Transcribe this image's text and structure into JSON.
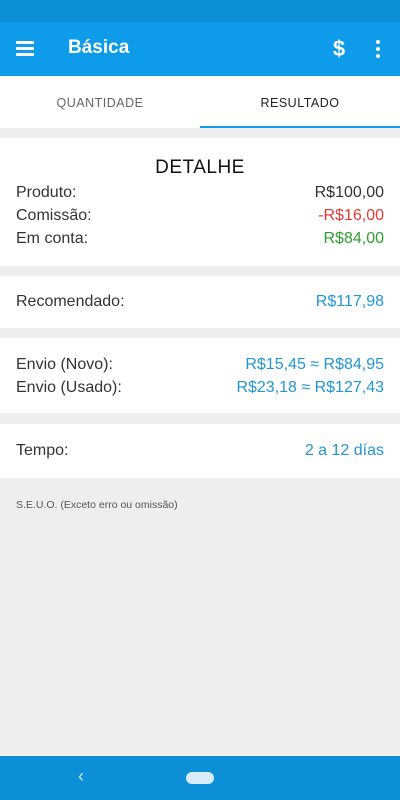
{
  "app_bar": {
    "title": "Básica",
    "currency_icon": "$",
    "menu_icon": "hamburger-menu-icon",
    "overflow_icon": "more-vert-icon"
  },
  "tabs": [
    {
      "label": "QUANTIDADE",
      "active": false
    },
    {
      "label": "RESULTADO",
      "active": true
    }
  ],
  "detail": {
    "heading": "DETALHE",
    "rows": [
      {
        "label": "Produto:",
        "value": "R$100,00"
      },
      {
        "label": "Comissão:",
        "value": "-R$16,00"
      },
      {
        "label": "Em conta:",
        "value": "R$84,00"
      }
    ]
  },
  "recommended": {
    "label": "Recomendado:",
    "value": "R$117,98"
  },
  "shipping": [
    {
      "label": "Envio (Novo):",
      "value": "R$15,45 ≈ R$84,95"
    },
    {
      "label": "Envio (Usado):",
      "value": "R$23,18 ≈ R$127,43"
    }
  ],
  "time": {
    "label": "Tempo:",
    "value": "2 a 12 días"
  },
  "disclaimer": "S.E.U.O. (Exceto erro ou omissão)",
  "colors": {
    "primary": "#0d9bea",
    "negative": "#e53935",
    "positive": "#2e9e2e",
    "link": "#2196d3"
  }
}
